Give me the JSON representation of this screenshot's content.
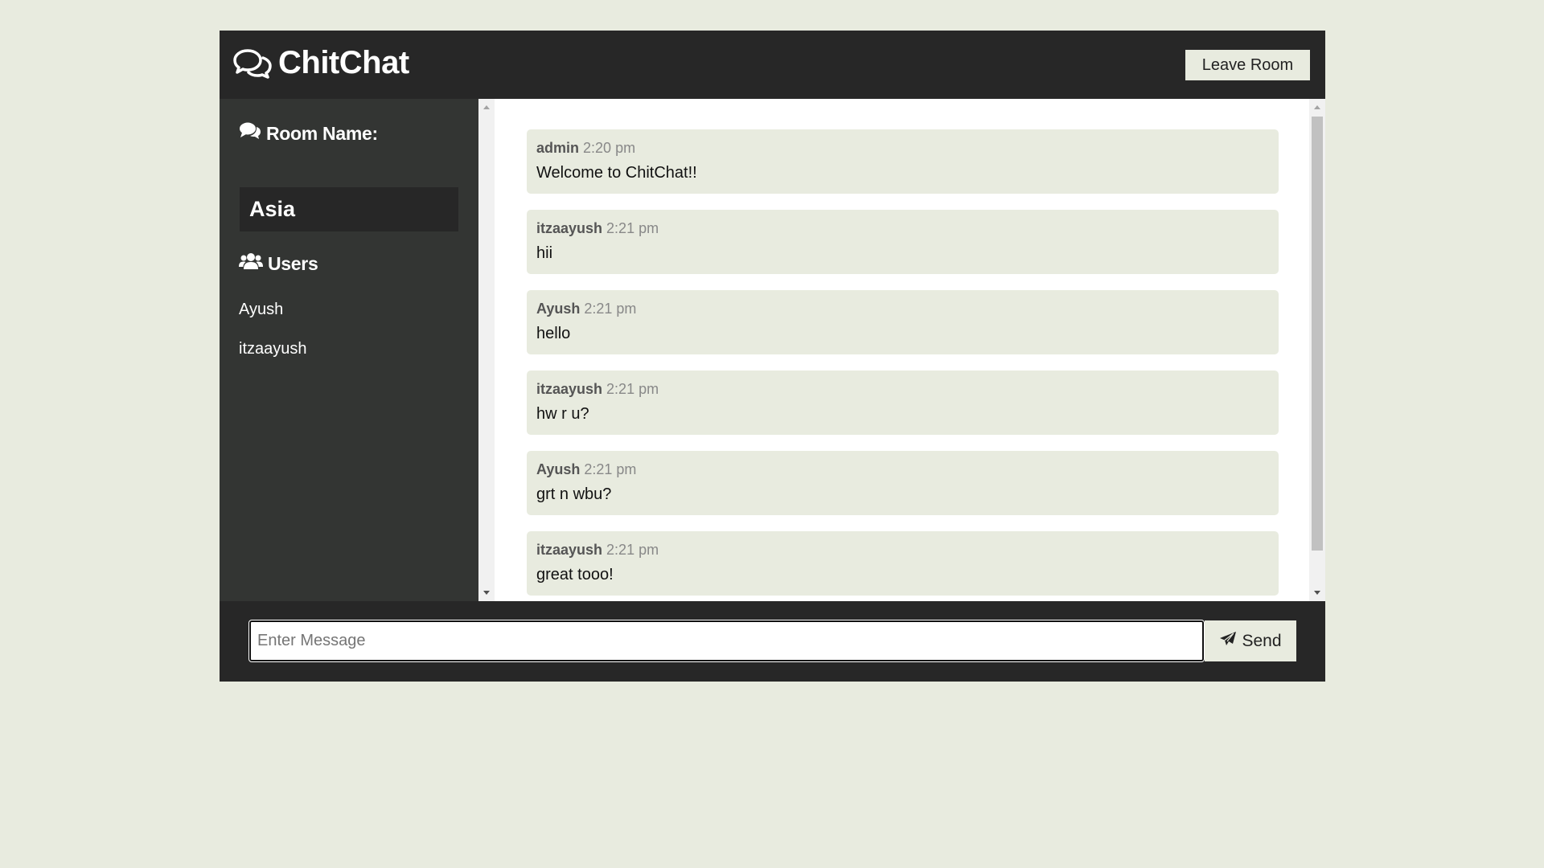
{
  "header": {
    "brand_icon": "comments-icon",
    "brand": "ChitChat",
    "leave_button": "Leave Room"
  },
  "sidebar": {
    "room_heading_icon": "comments-icon",
    "room_heading": "Room Name:",
    "room_name": "Asia",
    "users_heading_icon": "users-icon",
    "users_heading": "Users",
    "users": [
      "Ayush",
      "itzaayush"
    ]
  },
  "messages": [
    {
      "user": "admin",
      "time": "2:20 pm",
      "text": "Welcome to ChitChat!!"
    },
    {
      "user": "itzaayush",
      "time": "2:21 pm",
      "text": "hii"
    },
    {
      "user": "Ayush",
      "time": "2:21 pm",
      "text": "hello"
    },
    {
      "user": "itzaayush",
      "time": "2:21 pm",
      "text": "hw r u?"
    },
    {
      "user": "Ayush",
      "time": "2:21 pm",
      "text": "grt n wbu?"
    },
    {
      "user": "itzaayush",
      "time": "2:21 pm",
      "text": "great tooo!"
    }
  ],
  "composer": {
    "placeholder": "Enter Message",
    "value": "",
    "send_icon": "paper-plane-icon",
    "send_label": "Send"
  },
  "colors": {
    "background": "#e8ebdf",
    "header": "#272727",
    "sidebar": "#333533",
    "message_bubble": "#e8ebdf"
  }
}
